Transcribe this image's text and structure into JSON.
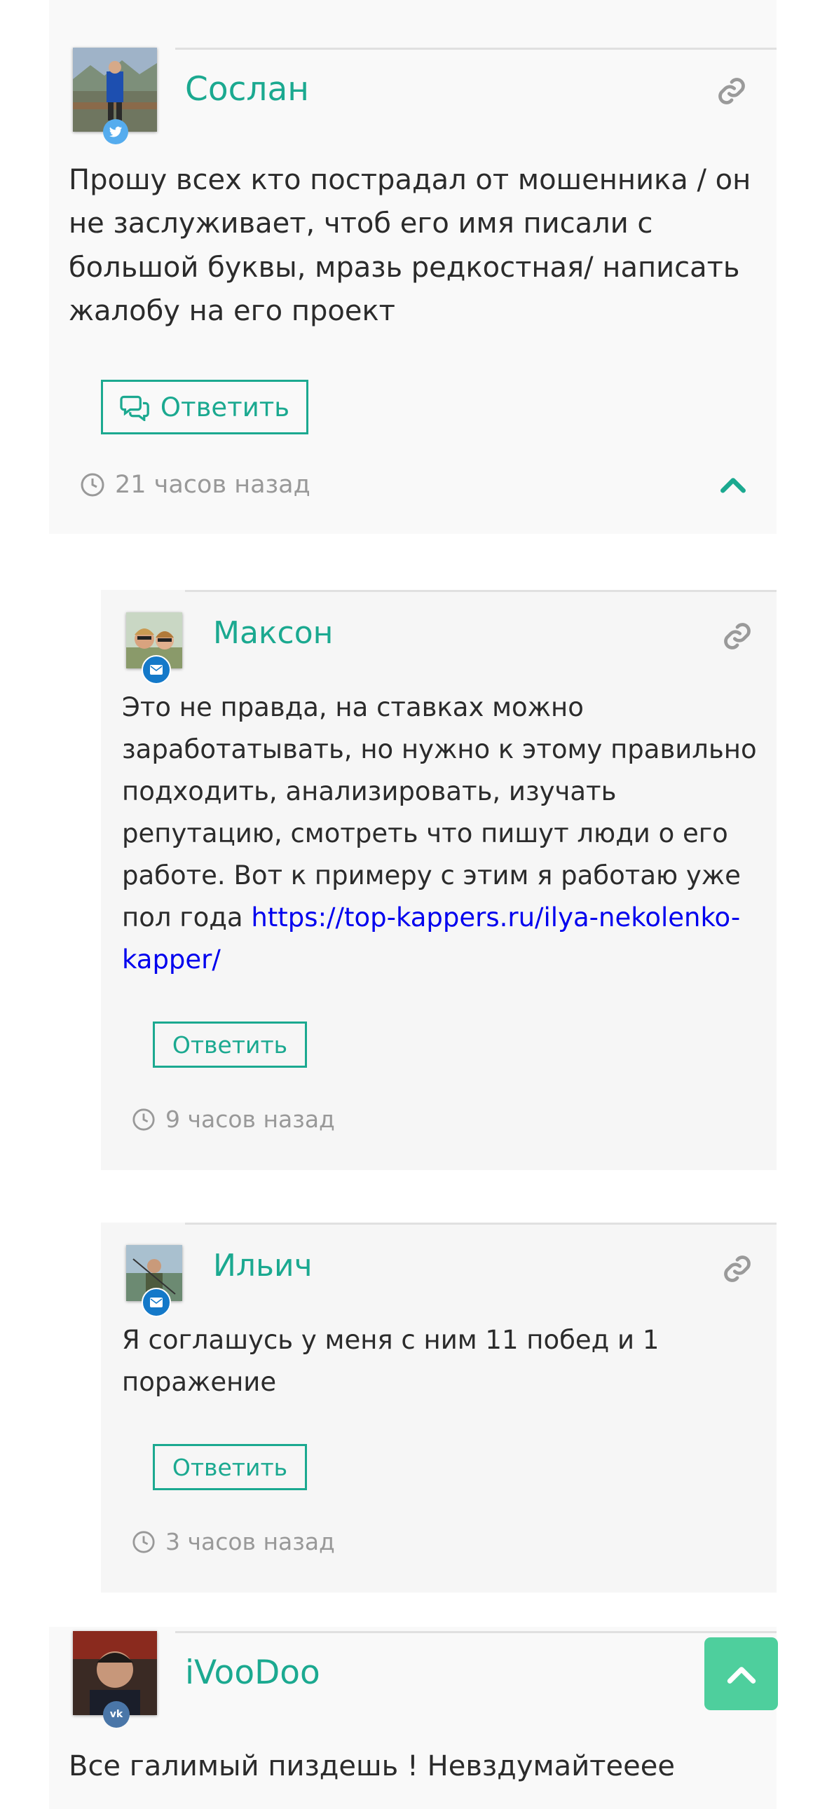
{
  "comments": [
    {
      "author": "Сослан",
      "text": "Прошу всех кто пострадал от мошенника / он не заслуживает, чтоб его имя писали с большой буквы, мразь редкостная/ написать жалобу на его проект",
      "reply_label": "Ответить",
      "time": "21 часов назад",
      "network_icon": "twitter-icon",
      "badge_color": "#55acee"
    },
    {
      "author": "Максон",
      "text_before": "Это не правда, на ставках можно заработатывать, но нужно к этому правильно подходить, анализировать, изучать репутацию, смотреть что пишут люди о его работе. Вот к примеру с этим я работаю уже пол года ",
      "link_text": "https://top-kappers.ru/ilya-nekolenko-kapper/",
      "reply_label": "Ответить",
      "time": "9 часов назад",
      "network_icon": "mail-icon",
      "badge_color": "#1479c9"
    },
    {
      "author": "Ильич",
      "text": "Я соглашусь у меня с ним 11 побед и 1 поражение",
      "reply_label": "Ответить",
      "time": "3 часов назад",
      "network_icon": "mail-icon",
      "badge_color": "#1479c9"
    },
    {
      "author": "iVooDoo",
      "text": "Все галимый пиздешь ! Невздумайтееее",
      "network_icon": "vk-icon",
      "badge_color": "#4a76a8"
    }
  ],
  "colors": {
    "accent": "#1ba990",
    "scroll_button": "#4ecf9d",
    "link": "#0000ee"
  }
}
